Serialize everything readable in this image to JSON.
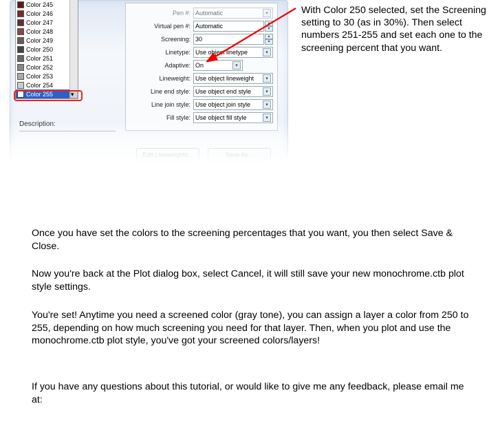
{
  "annotation": "With Color 250 selected, set the Screening setting to 30 (as in 30%). Then select numbers 251-255 and set each one to the screening percent that you want.",
  "colors": [
    {
      "label": "Color 245",
      "hex": "#5a1a1a"
    },
    {
      "label": "Color 246",
      "hex": "#7a2a2a"
    },
    {
      "label": "Color 247",
      "hex": "#5a3232"
    },
    {
      "label": "Color 248",
      "hex": "#8a4444"
    },
    {
      "label": "Color 249",
      "hex": "#6a5a5a"
    },
    {
      "label": "Color 250",
      "hex": "#444444"
    },
    {
      "label": "Color 251",
      "hex": "#686868"
    },
    {
      "label": "Color 252",
      "hex": "#888888"
    },
    {
      "label": "Color 253",
      "hex": "#aaaaaa"
    },
    {
      "label": "Color 254",
      "hex": "#cccccc"
    },
    {
      "label": "Color 255",
      "hex": "#ffffff"
    }
  ],
  "selectedIndex": 10,
  "description_label": "Description:",
  "props": {
    "pen_label": "Pen #:",
    "pen_value": "Automatic",
    "vpen_label": "Virtual pen #:",
    "vpen_value": "Automatic",
    "screening_label": "Screening:",
    "screening_value": "30",
    "linetype_label": "Linetype:",
    "linetype_value": "Use object linetype",
    "adaptive_label": "Adaptive:",
    "adaptive_value": "On",
    "lineweight_label": "Lineweight:",
    "lineweight_value": "Use object lineweight",
    "endstyle_label": "Line end style:",
    "endstyle_value": "Use object end style",
    "joinstyle_label": "Line join style:",
    "joinstyle_value": "Use object join style",
    "fillstyle_label": "Fill style:",
    "fillstyle_value": "Use object fill style"
  },
  "buttons": {
    "edit_lw": "Edit Lineweights...",
    "save_as": "Save As..."
  },
  "para1": "Once you have set the colors to the screening percentages that you want, you then select Save & Close.",
  "para2": "Now you're back at the Plot dialog box, select Cancel, it will still save your new monochrome.ctb plot style settings.",
  "para3": "You're set! Anytime you need a screened color (gray tone), you can assign a layer a color from 250 to 255, depending on how much screening you need for that layer. Then, when you plot and use the monochrome.ctb plot style, you've got your screened colors/layers!",
  "para4": "If you have any questions about this tutorial, or would like to give me any feedback, please email me at:"
}
